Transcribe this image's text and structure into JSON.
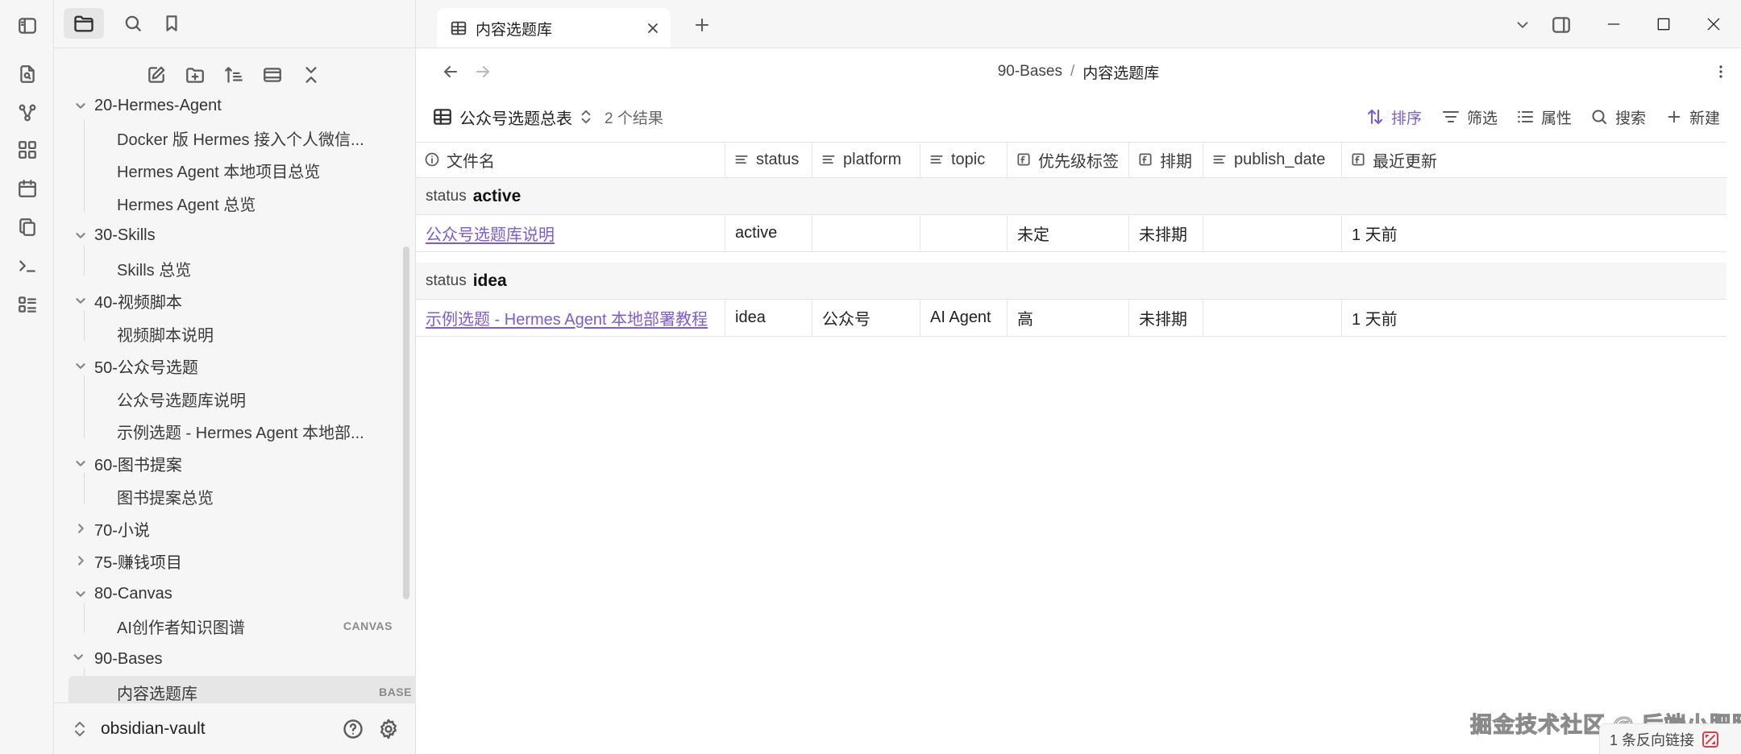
{
  "ribbon": {
    "icons": [
      "sidebar-toggle-icon",
      "quick-switcher-icon",
      "graph-view-icon",
      "canvas-icon",
      "daily-note-icon",
      "templates-icon",
      "command-palette-icon",
      "bases-icon"
    ]
  },
  "sidebar": {
    "top_tabs": [
      "files-icon",
      "search-icon",
      "bookmark-icon"
    ],
    "actions": [
      "new-note-icon",
      "new-folder-icon",
      "sort-icon",
      "collapse-all-icon",
      "auto-reveal-icon"
    ],
    "tree": [
      {
        "type": "folder",
        "label": "20-Hermes-Agent",
        "expanded": true
      },
      {
        "type": "file",
        "label": "Docker 版 Hermes 接入个人微信..."
      },
      {
        "type": "file",
        "label": "Hermes Agent 本地项目总览"
      },
      {
        "type": "file",
        "label": "Hermes Agent 总览"
      },
      {
        "type": "folder",
        "label": "30-Skills",
        "expanded": true
      },
      {
        "type": "file",
        "label": "Skills 总览"
      },
      {
        "type": "folder",
        "label": "40-视频脚本",
        "expanded": true
      },
      {
        "type": "file",
        "label": "视频脚本说明"
      },
      {
        "type": "folder",
        "label": "50-公众号选题",
        "expanded": true
      },
      {
        "type": "file",
        "label": "公众号选题库说明"
      },
      {
        "type": "file",
        "label": "示例选题 - Hermes Agent 本地部..."
      },
      {
        "type": "folder",
        "label": "60-图书提案",
        "expanded": true
      },
      {
        "type": "file",
        "label": "图书提案总览"
      },
      {
        "type": "folder",
        "label": "70-小说",
        "expanded": false
      },
      {
        "type": "folder",
        "label": "75-赚钱项目",
        "expanded": false
      },
      {
        "type": "folder",
        "label": "80-Canvas",
        "expanded": true
      },
      {
        "type": "file",
        "label": "AI创作者知识图谱",
        "badge": "CANVAS"
      },
      {
        "type": "folder",
        "label": "90-Bases",
        "expanded": true
      },
      {
        "type": "file",
        "label": "内容选题库",
        "badge": "BASE",
        "active": true
      }
    ],
    "vault_name": "obsidian-vault"
  },
  "tab": {
    "title": "内容选题库",
    "new_tab": "+"
  },
  "breadcrumb": {
    "folder": "90-Bases",
    "sep": "/",
    "file": "内容选题库"
  },
  "view": {
    "name": "公众号选题总表",
    "result_count": "2 个结果",
    "sort_label": "排序",
    "filter_label": "筛选",
    "props_label": "属性",
    "search_label": "搜索",
    "new_label": "新建"
  },
  "table": {
    "columns": [
      "文件名",
      "status",
      "platform",
      "topic",
      "优先级标签",
      "排期",
      "publish_date",
      "最近更新"
    ],
    "groups": [
      {
        "key_label": "status",
        "key_value": "active",
        "rows": [
          [
            "公众号选题库说明",
            "active",
            "",
            "",
            "未定",
            "未排期",
            "",
            "1 天前"
          ]
        ]
      },
      {
        "key_label": "status",
        "key_value": "idea",
        "rows": [
          [
            "示例选题 - Hermes Agent 本地部署教程",
            "idea",
            "公众号",
            "AI Agent",
            "高",
            "未排期",
            "",
            "1 天前"
          ]
        ]
      }
    ]
  },
  "watermark": "掘金技术社区 @ 后端小肥肠",
  "status_bar": {
    "backlinks": "1 条反向链接"
  },
  "colors": {
    "accent": "#7b5cd6",
    "sidebar_bg": "#f6f6f6",
    "active_item_bg": "#e6e6e6"
  }
}
